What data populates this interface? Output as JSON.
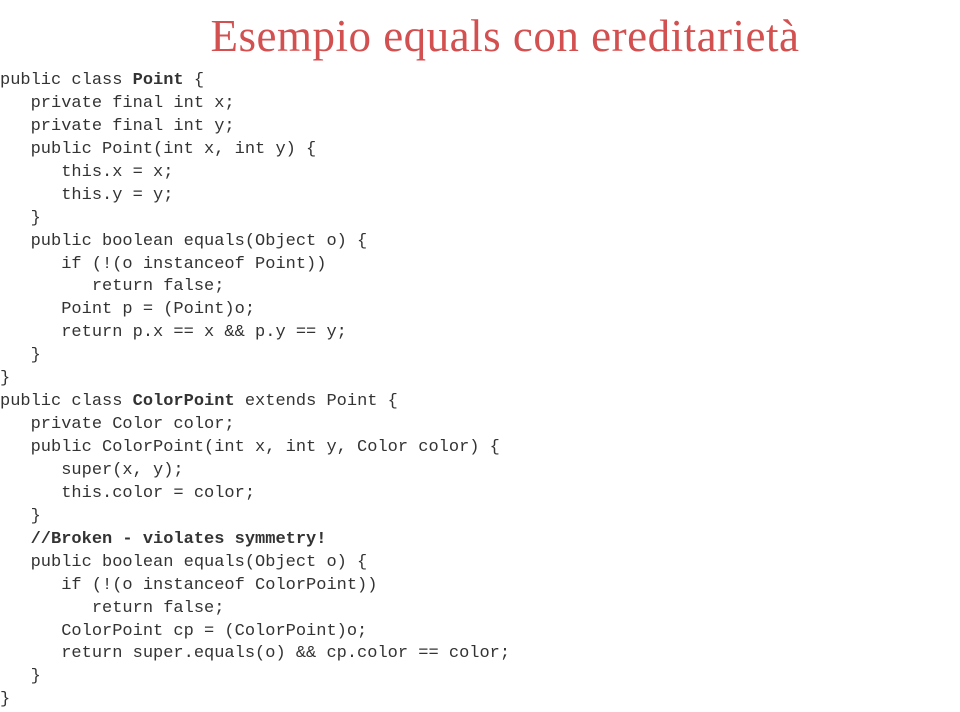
{
  "title": "Esempio equals con ereditarietà",
  "code": {
    "line1": "public class ",
    "line1b": "Point",
    "line1c": " {",
    "line2": "   private final int x;",
    "line3": "   private final int y;",
    "line4": "   public Point(int x, int y) {",
    "line5": "      this.x = x;",
    "line6": "      this.y = y;",
    "line7": "   }",
    "line8": "   public boolean equals(Object o) {",
    "line9": "      if (!(o instanceof Point))",
    "line10": "         return false;",
    "line11": "      Point p = (Point)o;",
    "line12": "      return p.x == x && p.y == y;",
    "line13": "   }",
    "line14": "}",
    "line15": "",
    "line16": "public class ",
    "line16b": "ColorPoint",
    "line16c": " extends Point {",
    "line17": "   private Color color;",
    "line18": "",
    "line19": "   public ColorPoint(int x, int y, Color color) {",
    "line20": "      super(x, y);",
    "line21": "      this.color = color;",
    "line22": "   }",
    "line23": "",
    "line24": "   //Broken - violates symmetry!",
    "line25": "   public boolean equals(Object o) {",
    "line26": "      if (!(o instanceof ColorPoint))",
    "line27": "         return false;",
    "line28": "      ColorPoint cp = (ColorPoint)o;",
    "line29": "      return super.equals(o) && cp.color == color;",
    "line30": "   }",
    "line31": "}"
  }
}
